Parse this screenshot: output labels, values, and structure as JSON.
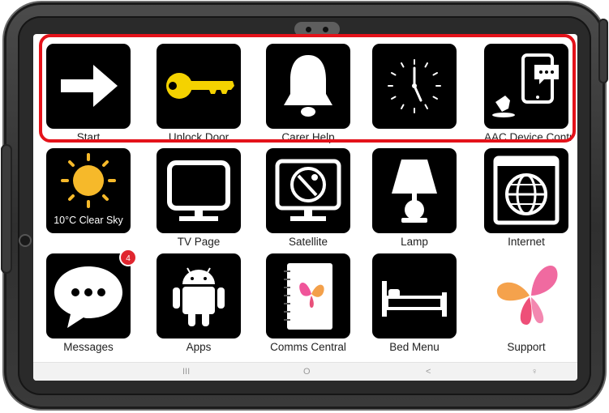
{
  "tiles_row1": [
    {
      "label": "Start",
      "icon": "arrow-right-icon"
    },
    {
      "label": "Unlock Door",
      "icon": "key-icon"
    },
    {
      "label": "Carer Help",
      "icon": "bell-icon"
    },
    {
      "label": "",
      "icon": "clock-icon"
    },
    {
      "label": "AAC Device Contr",
      "icon": "device-control-icon"
    }
  ],
  "tiles_row2": [
    {
      "label": "",
      "icon": "weather-sun-icon",
      "inner_text": "10°C  Clear Sky"
    },
    {
      "label": "TV Page",
      "icon": "tv-icon"
    },
    {
      "label": "Satellite",
      "icon": "satellite-dish-icon"
    },
    {
      "label": "Lamp",
      "icon": "lamp-icon"
    },
    {
      "label": "Internet",
      "icon": "globe-browser-icon"
    }
  ],
  "tiles_row3": [
    {
      "label": "Messages",
      "icon": "chat-bubble-icon",
      "badge": "4"
    },
    {
      "label": "Apps",
      "icon": "android-icon"
    },
    {
      "label": "Comms Central",
      "icon": "notebook-butterfly-icon"
    },
    {
      "label": "Bed Menu",
      "icon": "bed-icon"
    },
    {
      "label": "Support",
      "icon": "butterfly-icon"
    }
  ],
  "nav": {
    "recent": "III",
    "home": "O",
    "back": "<",
    "assist": "♀"
  },
  "colors": {
    "tile_bg": "#000000",
    "highlight": "#e4121a",
    "key": "#f4d200",
    "sun": "#f6b92a",
    "badge": "#e0262f"
  }
}
